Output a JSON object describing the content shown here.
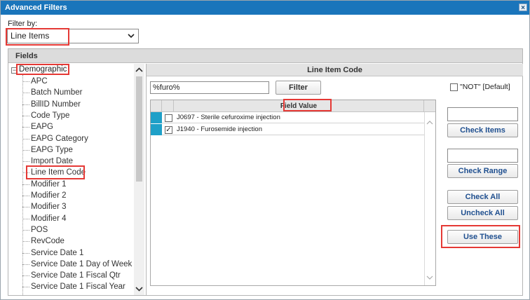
{
  "window": {
    "title": "Advanced Filters",
    "close_glyph": "×"
  },
  "filter_by": {
    "label": "Filter by:",
    "selected": "Line Items"
  },
  "fields": {
    "header": "Fields",
    "root": {
      "toggle": "−",
      "label": "Demographic"
    },
    "items": [
      "APC",
      "Batch Number",
      "BillID Number",
      "Code Type",
      "EAPG",
      "EAPG Category",
      "EAPG Type",
      "Import Date",
      "Line Item Code",
      "Modifier 1",
      "Modifier 2",
      "Modifier 3",
      "Modifier 4",
      "POS",
      "RevCode",
      "Service Date 1",
      "Service Date 1 Day of Week",
      "Service Date 1 Fiscal Qtr",
      "Service Date 1 Fiscal Year"
    ]
  },
  "line_item_code": {
    "header": "Line Item Code",
    "search_value": "%furo%",
    "filter_button": "Filter",
    "grid": {
      "column_header": "Field Value",
      "rows": [
        {
          "checked": false,
          "check_glyph": "",
          "text": "J0697 - Sterile cefuroxime injection"
        },
        {
          "checked": true,
          "check_glyph": "✓",
          "text": "J1940 - Furosemide injection"
        }
      ]
    },
    "not_option": {
      "checked": false,
      "label": "\"NOT\" [Default]"
    },
    "check_items_button": "Check Items",
    "check_range_button": "Check Range",
    "check_all_button": "Check All",
    "uncheck_all_button": "Uncheck All",
    "use_these_button": "Use These"
  },
  "colors": {
    "titlebar": "#1a75bb",
    "row_marker": "#1fa0c8",
    "highlight": "#e53935",
    "button_text": "#1f4f8f"
  },
  "icons": [
    "close-icon",
    "chevron-down-icon",
    "scroll-up-icon",
    "scroll-down-icon",
    "collapse-icon",
    "checkmark-icon"
  ]
}
